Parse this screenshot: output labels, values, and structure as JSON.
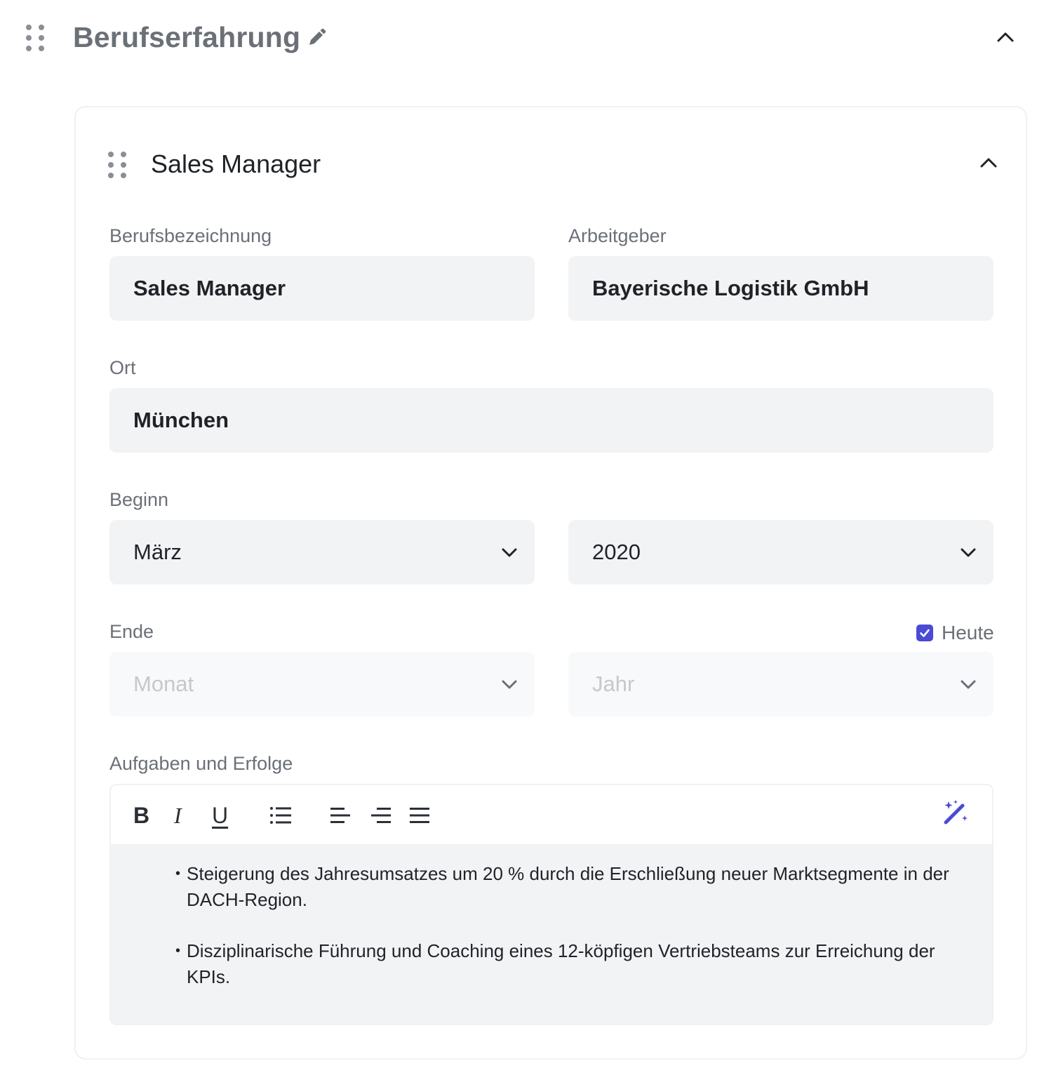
{
  "section": {
    "title": "Berufserfahrung"
  },
  "entry": {
    "title": "Sales Manager",
    "fields": {
      "job_title": {
        "label": "Berufsbezeichnung",
        "value": "Sales Manager"
      },
      "employer": {
        "label": "Arbeitgeber",
        "value": "Bayerische Logistik GmbH"
      },
      "location": {
        "label": "Ort",
        "value": "München"
      },
      "start": {
        "label": "Beginn",
        "month": "März",
        "year": "2020"
      },
      "end": {
        "label": "Ende",
        "month_placeholder": "Monat",
        "year_placeholder": "Jahr",
        "today_label": "Heute",
        "today_checked": true
      },
      "description": {
        "label": "Aufgaben und Erfolge",
        "toolbar": {
          "bold": "B",
          "italic": "I",
          "underline": "U"
        },
        "bullets": [
          "Steigerung des Jahresumsatzes um 20 % durch die Erschließung neuer Marktsegmente in der DACH-Region.",
          "Disziplinarische Führung und Coaching eines 12-köpfigen Vertriebsteams zur Erreichung der KPIs."
        ]
      }
    }
  },
  "colors": {
    "accent": "#4a4ad6",
    "field_bg": "#f2f3f5",
    "label": "#6b7078"
  }
}
